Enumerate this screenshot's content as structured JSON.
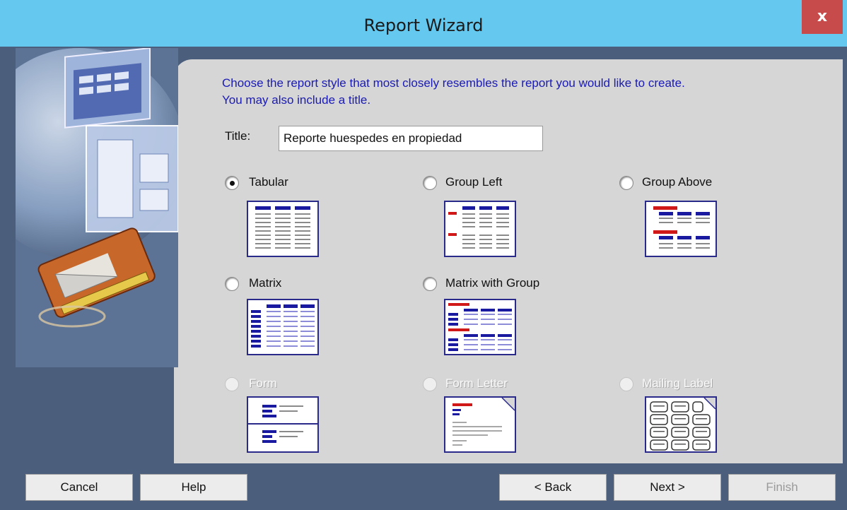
{
  "window": {
    "title": "Report Wizard",
    "close_label": "x"
  },
  "instructions": {
    "line1": "Choose the report style that most closely resembles the report you would like to create.",
    "line2": "You may also include a title."
  },
  "title_field": {
    "label": "Title:",
    "value": "Reporte huespedes en propiedad"
  },
  "styles": [
    {
      "label": "Tabular",
      "selected": true,
      "enabled": true
    },
    {
      "label": "Group Left",
      "selected": false,
      "enabled": true
    },
    {
      "label": "Group Above",
      "selected": false,
      "enabled": true
    },
    {
      "label": "Matrix",
      "selected": false,
      "enabled": true
    },
    {
      "label": "Matrix with Group",
      "selected": false,
      "enabled": true
    },
    {
      "label": "Form",
      "selected": false,
      "enabled": false
    },
    {
      "label": "Form Letter",
      "selected": false,
      "enabled": false
    },
    {
      "label": "Mailing Label",
      "selected": false,
      "enabled": false
    }
  ],
  "buttons": {
    "cancel": "Cancel",
    "help": "Help",
    "back": "< Back",
    "next": "Next >",
    "finish": "Finish"
  },
  "colors": {
    "titlebar": "#64c8ef",
    "close": "#c74b4b",
    "instruction_text": "#1a1ab5",
    "panel": "#d6d6d6",
    "frame": "#4b5f7d"
  }
}
